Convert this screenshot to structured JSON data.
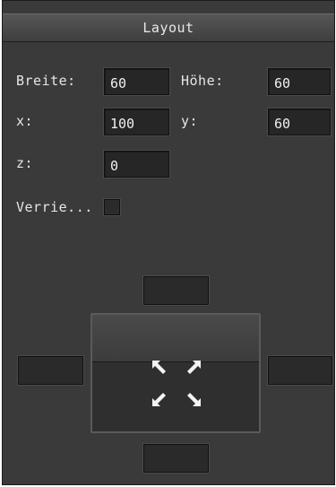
{
  "panel": {
    "title": "Layout"
  },
  "fields": {
    "breite": {
      "label": "Breite:",
      "value": "60"
    },
    "hoehe": {
      "label": "Höhe:",
      "value": "60"
    },
    "x": {
      "label": "x:",
      "value": "100"
    },
    "y": {
      "label": "y:",
      "value": "60"
    },
    "z": {
      "label": "z:",
      "value": "0"
    }
  },
  "lock": {
    "label": "Verrie...",
    "checked": false
  },
  "anchor": {
    "top_value": "",
    "left_value": "",
    "right_value": "",
    "bottom_value": "",
    "icons": [
      "arrow-up-left-icon",
      "arrow-up-right-icon",
      "arrow-down-left-icon",
      "arrow-down-right-icon"
    ]
  },
  "colors": {
    "panel_bg": "#3a3a3a",
    "field_bg": "#262626",
    "text": "#e6e6e6"
  }
}
